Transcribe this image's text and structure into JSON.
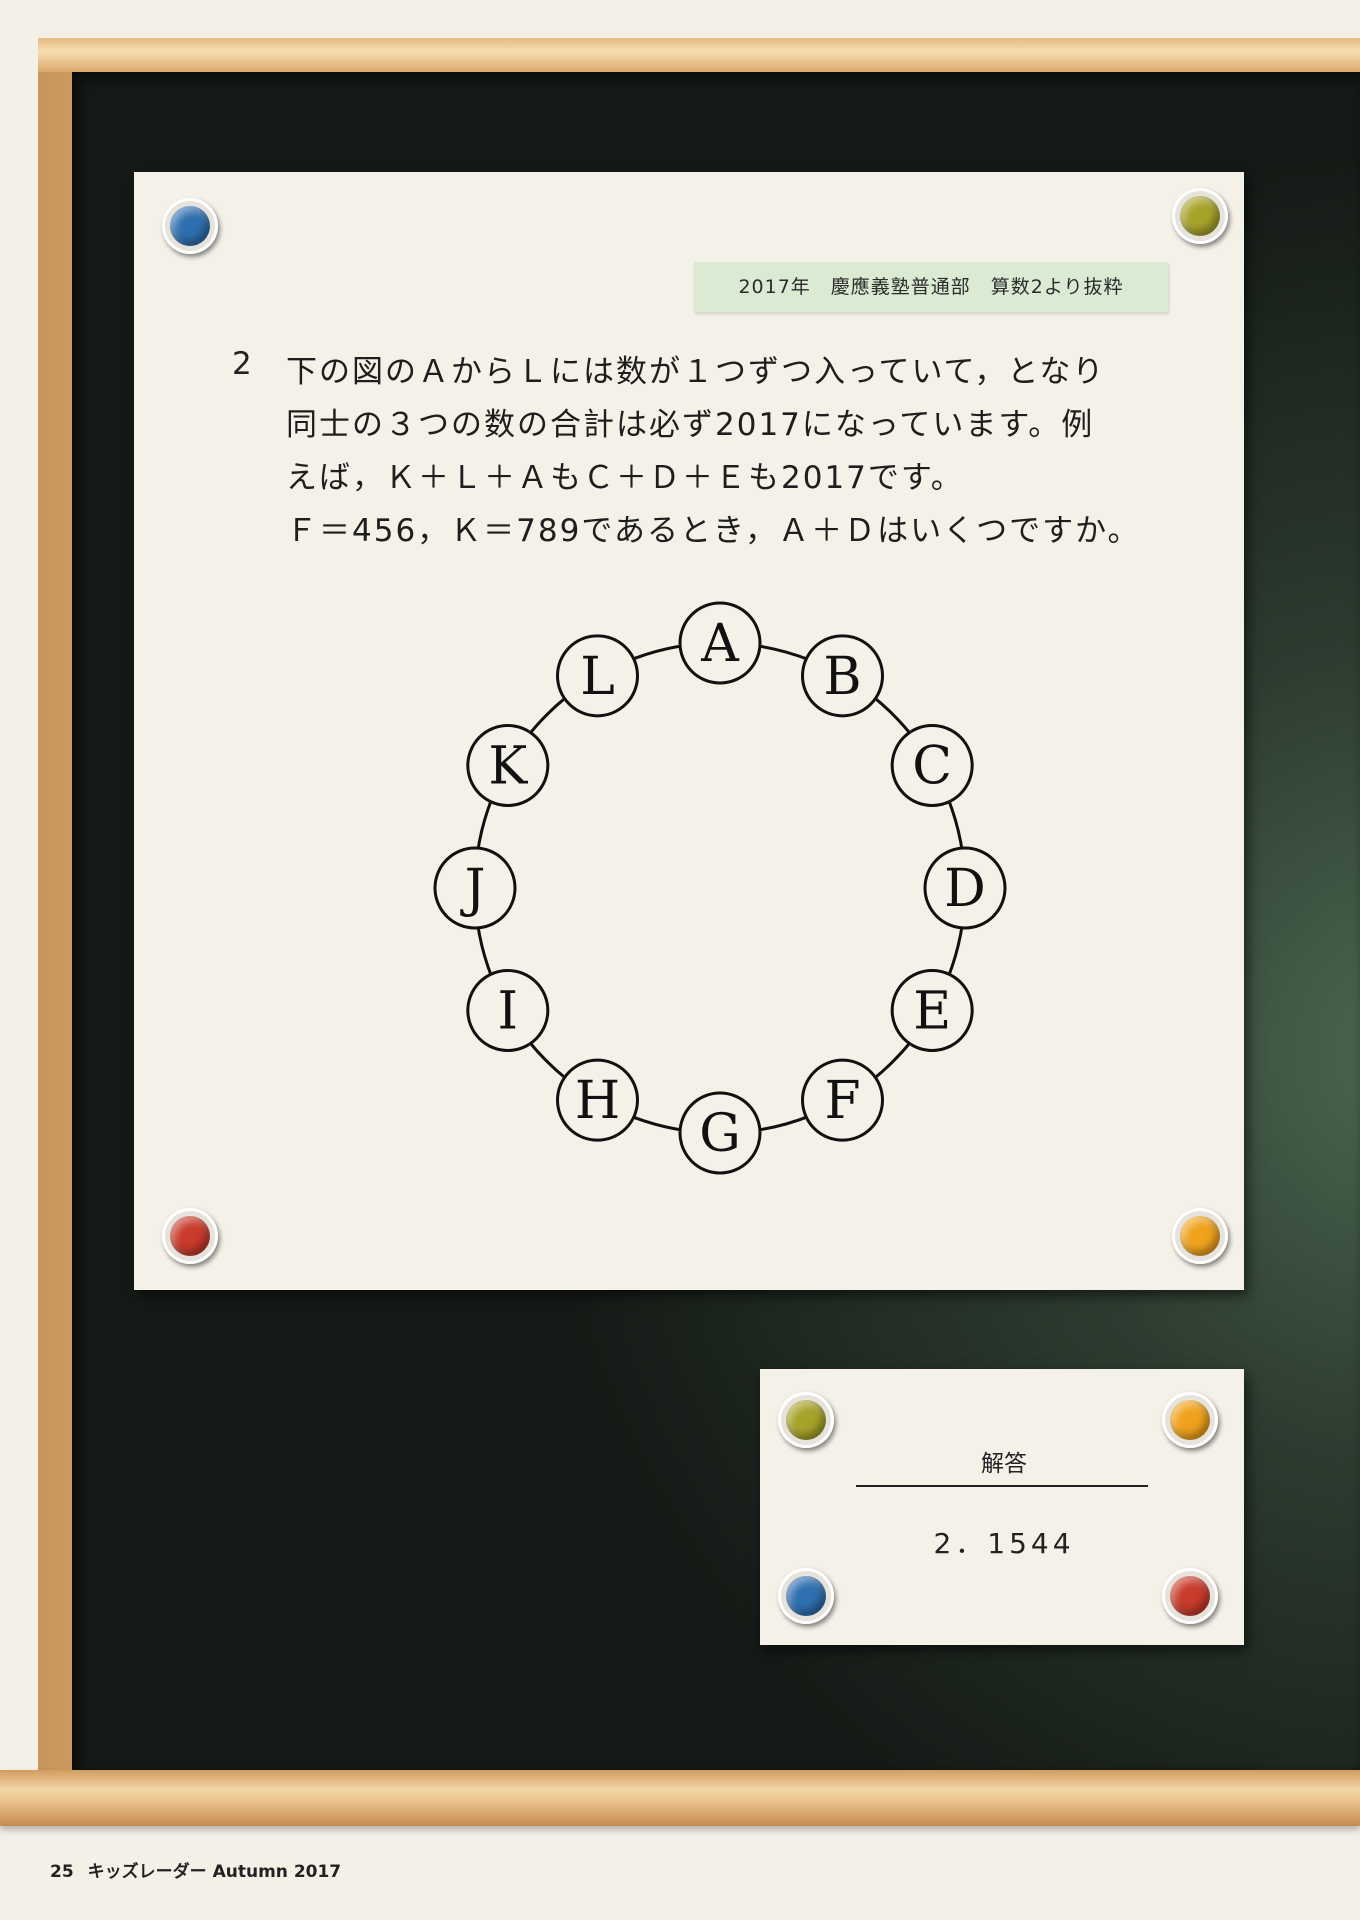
{
  "source_tag": "2017年　慶應義塾普通部　算数2より抜粋",
  "question": {
    "number": "2",
    "lines": [
      "下の図のＡからＬには数が１つずつ入っていて，となり",
      "同士の３つの数の合計は必ず2017になっています。例",
      "えば，Ｋ＋Ｌ＋ＡもＣ＋Ｄ＋Ｅも2017です。",
      "Ｆ＝456，Ｋ＝789であるとき，Ａ＋Ｄはいくつですか。"
    ]
  },
  "diagram": {
    "nodes": [
      "A",
      "B",
      "C",
      "D",
      "E",
      "F",
      "G",
      "H",
      "I",
      "J",
      "K",
      "L"
    ]
  },
  "answer": {
    "title": "解答",
    "value": "2．1544"
  },
  "footer": {
    "page": "25",
    "magazine": "キッズレーダー Autumn 2017"
  },
  "pins": {
    "paper": [
      "blue",
      "olive",
      "red",
      "orange"
    ],
    "answer": [
      "olive",
      "orange",
      "blue",
      "red"
    ]
  },
  "colors": {
    "blue": "#2f6fb0",
    "olive": "#a6a32a",
    "red": "#c93b2c",
    "orange": "#f0a21d"
  }
}
